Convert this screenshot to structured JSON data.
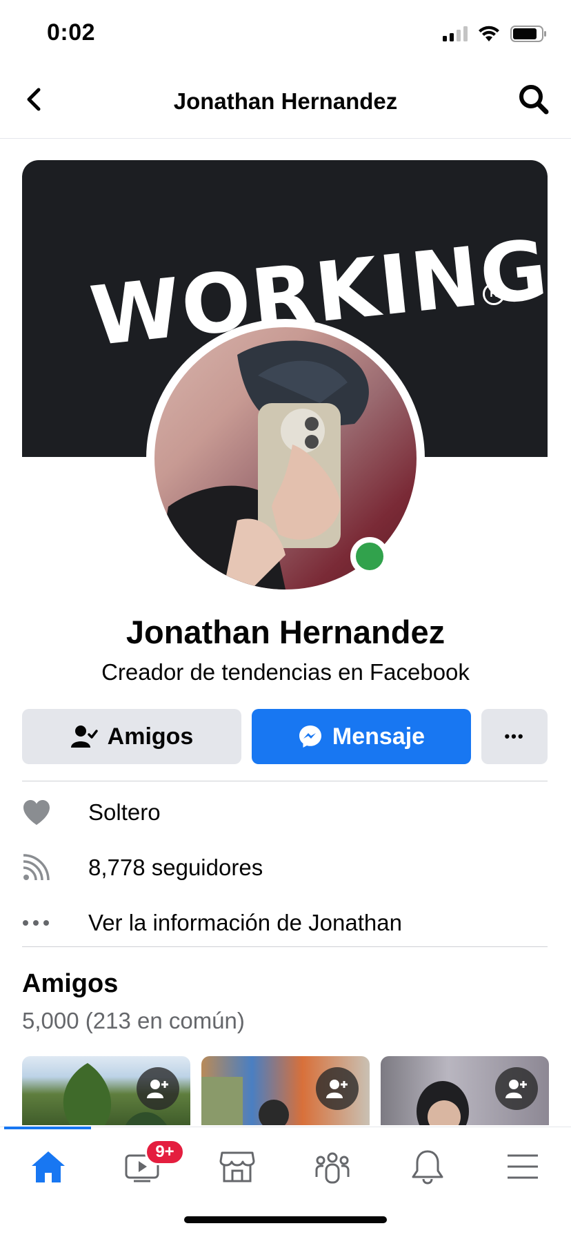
{
  "status_bar": {
    "time": "0:02"
  },
  "header": {
    "title": "Jonathan Hernandez"
  },
  "cover": {
    "text": "WORKING",
    "registered_mark": "R"
  },
  "profile": {
    "name": "Jonathan Hernandez",
    "subtitle": "Creador de tendencias en Facebook",
    "online_color": "#31a24c"
  },
  "actions": {
    "friends_label": "Amigos",
    "message_label": "Mensaje",
    "more_label": "•••"
  },
  "info": [
    {
      "icon": "heart-icon",
      "text": "Soltero"
    },
    {
      "icon": "followers-icon",
      "text": "8,778 seguidores"
    },
    {
      "icon": "more-dots-icon",
      "text": "Ver la información de Jonathan"
    }
  ],
  "friends": {
    "title": "Amigos",
    "count": "5,000 (213 en común)"
  },
  "tabbar": {
    "watch_badge": "9+",
    "accent": "#1877f2"
  }
}
